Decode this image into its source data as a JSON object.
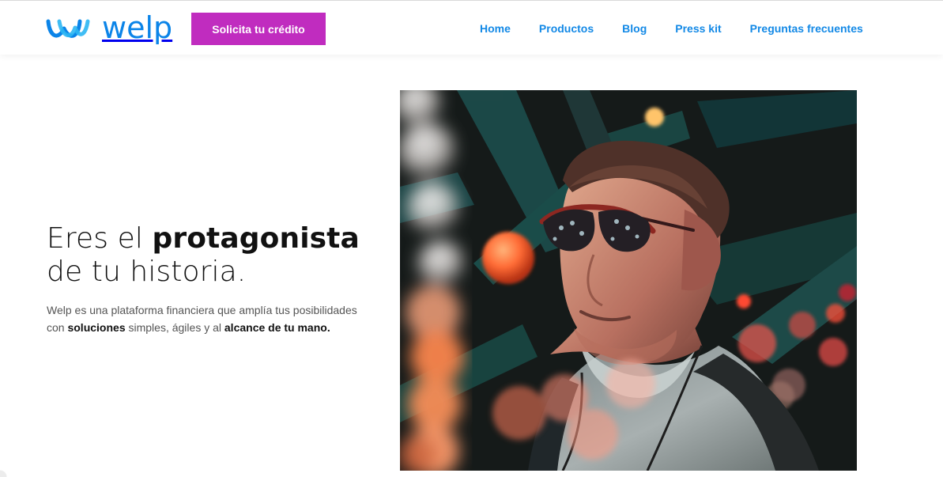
{
  "site": {
    "logo": {
      "icon": "welp-wave-logo-icon",
      "text": "welp",
      "color": "#0b84e8"
    },
    "cta_button": {
      "label": "Solicita tu crédito",
      "color": "#c02cbf"
    },
    "nav": {
      "color": "#1389e6",
      "items": [
        {
          "label": "Home"
        },
        {
          "label": "Productos"
        },
        {
          "label": "Blog"
        },
        {
          "label": "Press kit"
        },
        {
          "label": "Preguntas frecuentes"
        }
      ]
    }
  },
  "hero": {
    "headline": {
      "part1": "Eres el ",
      "emphasis": "protagonista",
      "part2": "de tu historia."
    },
    "description": {
      "part1": "Welp es una plataforma financiera que amplía tus posibilidades con ",
      "emphasis1": "soluciones",
      "part2": " simples, ágiles y al ",
      "emphasis2": "alcance de tu mano."
    },
    "image": {
      "subject": "man-wearing-sunglasses-with-bokeh-lights"
    }
  }
}
